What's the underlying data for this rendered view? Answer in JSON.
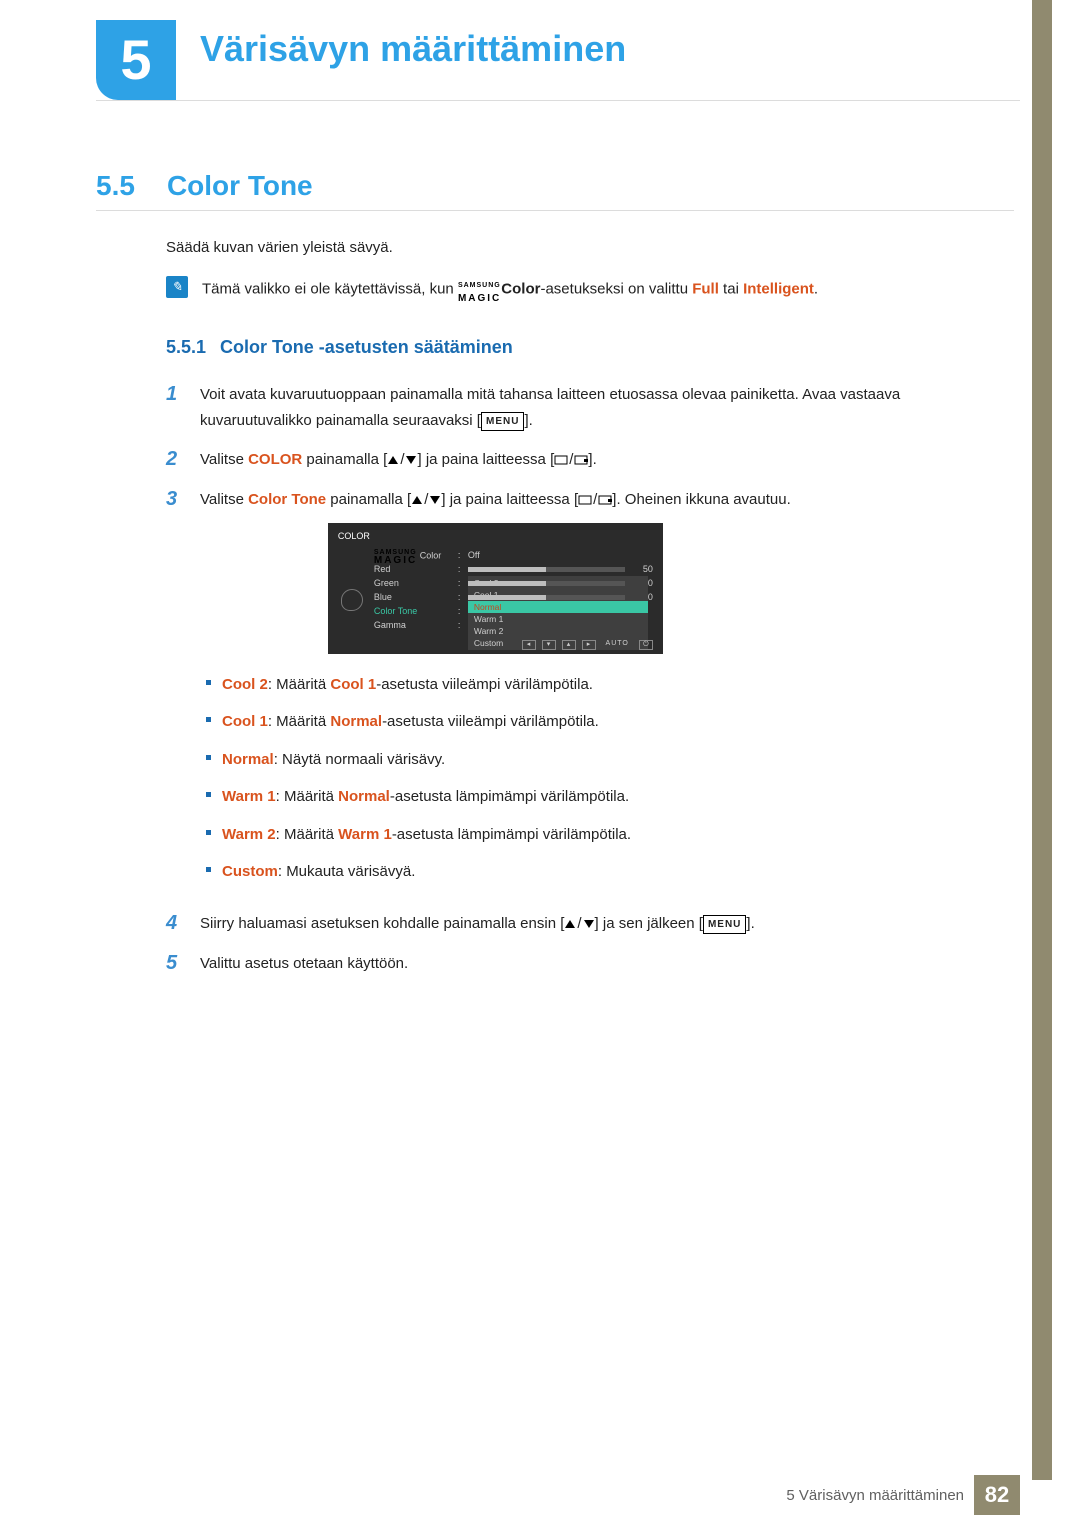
{
  "chapter": {
    "number": "5",
    "title": "Värisävyn määrittäminen"
  },
  "h2": {
    "num": "5.5",
    "title": "Color Tone"
  },
  "lead": "Säädä kuvan värien yleistä sävyä.",
  "note": {
    "pre": "Tämä valikko ei ole käytettävissä, kun ",
    "magic_top": "SAMSUNG",
    "magic_bot": "MAGIC",
    "color_word": "Color",
    "mid": "-asetukseksi on valittu ",
    "full": "Full",
    "or": " tai ",
    "intelligent": "Intelligent",
    "end": "."
  },
  "h3": {
    "num": "5.5.1",
    "title": "Color Tone -asetusten säätäminen"
  },
  "steps": {
    "s1a": "Voit avata kuvaruutuoppaan painamalla mitä tahansa laitteen etuosassa olevaa painiketta. Avaa vastaava kuvaruutuvalikko painamalla seuraavaksi [",
    "s1b": "].",
    "menu_key": "MENU",
    "s2a": "Valitse ",
    "s2_color": "COLOR",
    "s2b": " painamalla [",
    "s2c": "] ja paina laitteessa [",
    "s2d": "].",
    "s3a": "Valitse ",
    "s3_ct": "Color Tone",
    "s3b": " painamalla [",
    "s3c": "] ja paina laitteessa [",
    "s3d": "]. Oheinen ikkuna avautuu.",
    "s4a": "Siirry haluamasi asetuksen kohdalle painamalla ensin [",
    "s4b": "] ja sen jälkeen [",
    "s4c": "].",
    "s5": "Valittu asetus otetaan käyttöön."
  },
  "osd": {
    "title": "COLOR",
    "rows": {
      "magic": {
        "label_top": "SAMSUNG",
        "label_bot": "MAGIC",
        "suffix": " Color",
        "value": "Off"
      },
      "red": {
        "label": "Red",
        "value": "50",
        "pct": 50
      },
      "green": {
        "label": "Green",
        "value": "50",
        "pct": 50
      },
      "blue": {
        "label": "Blue",
        "value": "50",
        "pct": 50
      },
      "color_tone": {
        "label": "Color Tone"
      },
      "gamma": {
        "label": "Gamma"
      }
    },
    "dropdown": [
      "Cool 2",
      "Cool 1",
      "Normal",
      "Warm 1",
      "Warm 2",
      "Custom"
    ],
    "dropdown_selected": "Normal",
    "auto": "AUTO"
  },
  "bullets": [
    {
      "k": "Cool 2",
      "pre": ": Määritä ",
      "ref": "Cool 1",
      "post": "-asetusta viileämpi värilämpötila."
    },
    {
      "k": "Cool 1",
      "pre": ": Määritä ",
      "ref": "Normal",
      "post": "-asetusta viileämpi värilämpötila."
    },
    {
      "k": "Normal",
      "pre": ": ",
      "ref": "",
      "post": "Näytä normaali värisävy."
    },
    {
      "k": "Warm 1",
      "pre": ": Määritä ",
      "ref": "Normal",
      "post": "-asetusta lämpimämpi värilämpötila."
    },
    {
      "k": "Warm 2",
      "pre": ": Määritä ",
      "ref": "Warm 1",
      "post": "-asetusta lämpimämpi värilämpötila."
    },
    {
      "k": "Custom",
      "pre": ": ",
      "ref": "",
      "post": "Mukauta värisävyä."
    }
  ],
  "footer": {
    "text": "5 Värisävyn määrittäminen",
    "page": "82"
  }
}
